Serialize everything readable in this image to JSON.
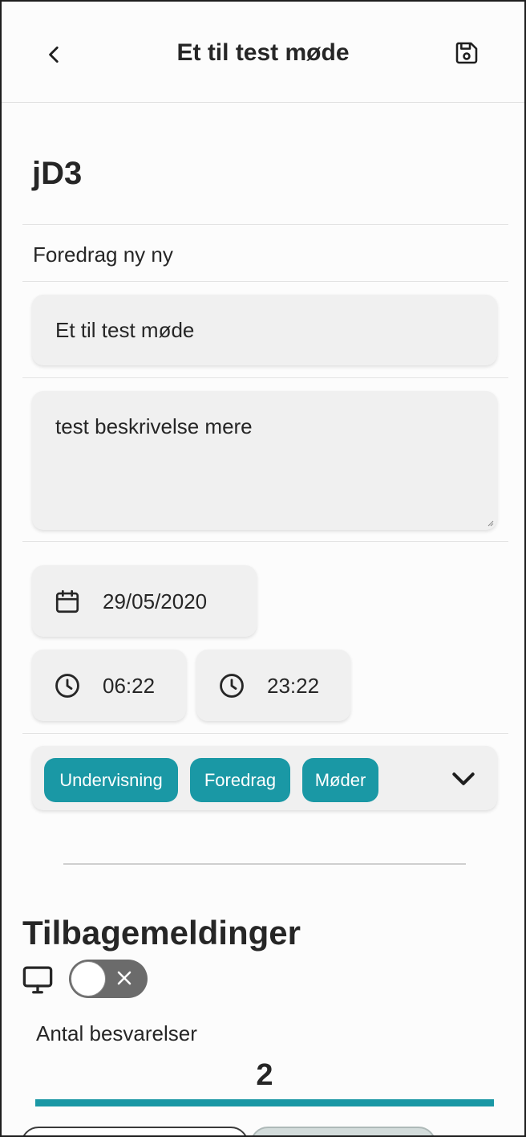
{
  "header": {
    "title": "Et til test møde",
    "back_icon": "chevron-left-icon",
    "save_icon": "floppy-disk-icon"
  },
  "meeting": {
    "code": "jD3",
    "type": "Foredrag ny ny",
    "title_value": "Et til test møde",
    "description_value": "test beskrivelse mere",
    "date": "29/05/2020",
    "start_time": "06:22",
    "end_time": "23:22"
  },
  "tags": {
    "items": [
      "Undervisning",
      "Foredrag",
      "Møder"
    ],
    "dropdown_icon": "chevron-down-icon",
    "tag_color": "#1a98a5"
  },
  "feedback": {
    "title": "Tilbagemeldinger",
    "screen_icon": "monitor-icon",
    "toggle_on": false,
    "responses_label": "Antal besvarelser",
    "responses_value": "2",
    "progress_fraction": 1.0,
    "accent": "#1a98a5"
  }
}
